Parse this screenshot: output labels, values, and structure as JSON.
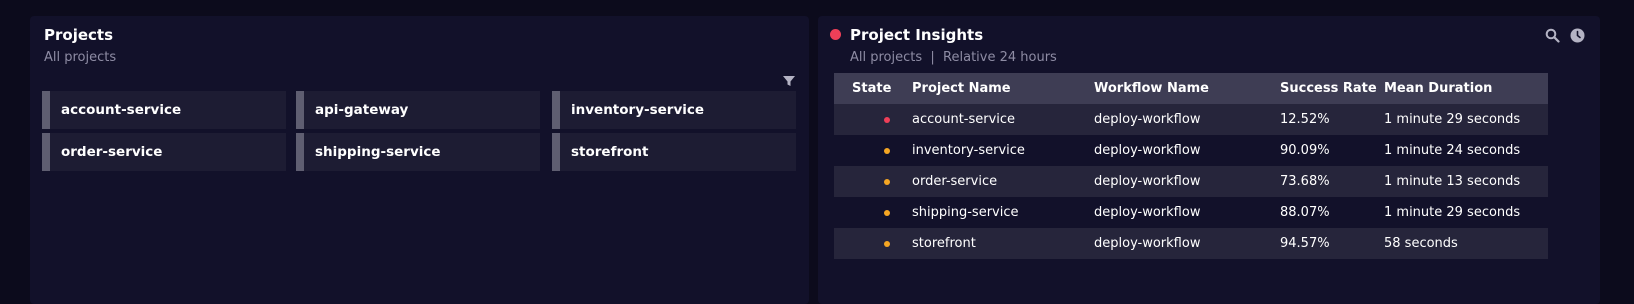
{
  "projects_panel": {
    "title": "Projects",
    "subtitle": "All projects",
    "tiles": [
      {
        "label": "account-service"
      },
      {
        "label": "api-gateway"
      },
      {
        "label": "inventory-service"
      },
      {
        "label": "order-service"
      },
      {
        "label": "shipping-service"
      },
      {
        "label": "storefront"
      }
    ]
  },
  "insights_panel": {
    "title": "Project Insights",
    "subtitle": "All projects  |  Relative 24 hours",
    "title_status_color": "#ef3f58",
    "icons": [
      "search-icon",
      "clock-icon"
    ],
    "columns": [
      "State",
      "Project Name",
      "Workflow Name",
      "Success Rate",
      "Mean Duration"
    ],
    "rows": [
      {
        "state_color": "#ef3f58",
        "project": "account-service",
        "workflow": "deploy-workflow",
        "success_rate": "12.52%",
        "mean_duration": "1 minute 29 seconds"
      },
      {
        "state_color": "#f5a623",
        "project": "inventory-service",
        "workflow": "deploy-workflow",
        "success_rate": "90.09%",
        "mean_duration": "1 minute 24 seconds"
      },
      {
        "state_color": "#f5a623",
        "project": "order-service",
        "workflow": "deploy-workflow",
        "success_rate": "73.68%",
        "mean_duration": "1 minute 13 seconds"
      },
      {
        "state_color": "#f5a623",
        "project": "shipping-service",
        "workflow": "deploy-workflow",
        "success_rate": "88.07%",
        "mean_duration": "1 minute 29 seconds"
      },
      {
        "state_color": "#f5a623",
        "project": "storefront",
        "workflow": "deploy-workflow",
        "success_rate": "94.57%",
        "mean_duration": "58 seconds"
      }
    ]
  }
}
